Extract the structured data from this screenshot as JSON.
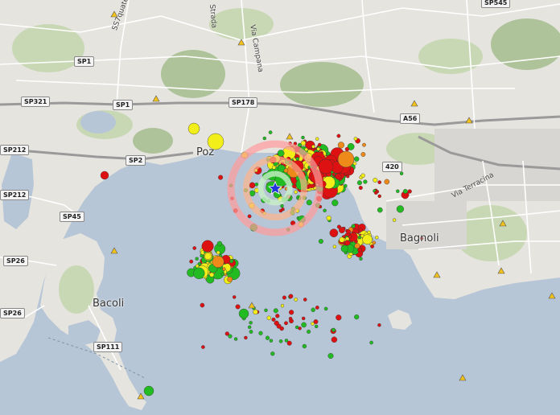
{
  "map": {
    "colors": {
      "sea": "#b7c6d6",
      "land": "#e6e4df",
      "urban": "#d8d6d2",
      "green": "#c9d8b4",
      "hill": "#aec39a",
      "road": "#ffffff",
      "highway": "#9a9a9a",
      "quake_red": "#dd1111",
      "quake_yellow": "#f2ee1a",
      "quake_green": "#22bb22",
      "quake_orange": "#ee8a1a",
      "epicenter": "#2233dd",
      "ring": "#ff8a8a"
    },
    "road_labels": [
      {
        "id": "sp545",
        "text": "SP545"
      },
      {
        "id": "sp1a",
        "text": "SP1"
      },
      {
        "id": "sp321",
        "text": "SP321"
      },
      {
        "id": "sp1b",
        "text": "SP1"
      },
      {
        "id": "sp178",
        "text": "SP178"
      },
      {
        "id": "a56",
        "text": "A56"
      },
      {
        "id": "sp212a",
        "text": "SP212"
      },
      {
        "id": "sp2",
        "text": "SP2"
      },
      {
        "id": "sp212b",
        "text": "SP212"
      },
      {
        "id": "sp45",
        "text": "SP45"
      },
      {
        "id": "sp26a",
        "text": "SP26"
      },
      {
        "id": "sp26b",
        "text": "SP26"
      },
      {
        "id": "sp111",
        "text": "SP111"
      },
      {
        "id": "t420",
        "text": "420"
      }
    ],
    "place_labels": [
      {
        "id": "pozzuoli",
        "text": "Poz"
      },
      {
        "id": "bagnoli",
        "text": "Bagnoli"
      },
      {
        "id": "bacoli",
        "text": "Bacoli"
      }
    ],
    "street_labels": [
      {
        "id": "s1",
        "text": "SS7quater"
      },
      {
        "id": "s2",
        "text": "Strada"
      },
      {
        "id": "s3",
        "text": "Via Campana"
      },
      {
        "id": "s4",
        "text": "Via Terracina"
      }
    ],
    "epicenter": {
      "label": "epicenter",
      "rings": 3
    }
  }
}
